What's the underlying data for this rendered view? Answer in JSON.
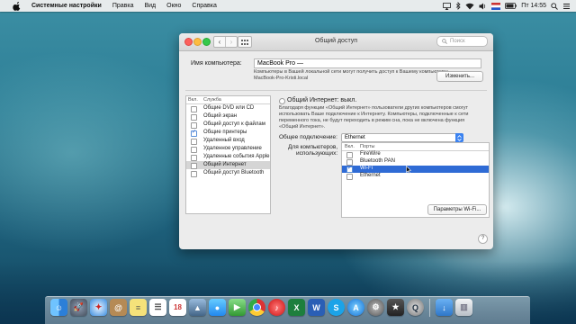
{
  "menubar": {
    "app_name": "Системные настройки",
    "items": [
      "Правка",
      "Вид",
      "Окно",
      "Справка"
    ],
    "clock": "Пт 14:55"
  },
  "window": {
    "title": "Общий доступ",
    "search_placeholder": "Поиск",
    "computer_name_label": "Имя компьютера:",
    "computer_name_value": "MacBook Pro —",
    "name_info_line1": "Компьютеры в Вашей локальной сети могут получить доступ к Вашему компьютеру:",
    "name_info_line2": "MacBook-Pro-Kristi.local",
    "change_button": "Изменить...",
    "services_header_on": "Вкл.",
    "services_header_service": "Служба",
    "services": [
      {
        "label": "Общие DVD или CD",
        "checked": false
      },
      {
        "label": "Общий экран",
        "checked": false
      },
      {
        "label": "Общий доступ к файлам",
        "checked": false
      },
      {
        "label": "Общие принтеры",
        "checked": true
      },
      {
        "label": "Удаленный вход",
        "checked": false
      },
      {
        "label": "Удаленное управление",
        "checked": false
      },
      {
        "label": "Удаленные события Apple",
        "checked": false
      },
      {
        "label": "Общий Интернет",
        "checked": false,
        "selected": true
      },
      {
        "label": "Общий доступ Bluetooth",
        "checked": false
      }
    ],
    "internet_status": "Общий Интернет: выкл.",
    "desc_lines": [
      "Благодаря функции «Общий Интернет» пользователи других компьютеров смогут",
      "использовать Ваше подключение к Интернету. Компьютеры, подключенные к сети",
      "переменного тока, не будут переходить в режим сна, пока не включена функция",
      "«Общий Интернет»."
    ],
    "share_from_label": "Общее подключение:",
    "share_from_value": "Ethernet",
    "to_computers_label1": "Для компьютеров,",
    "to_computers_label2": "использующих:",
    "ports_header_on": "Вкл.",
    "ports_header_ports": "Порты",
    "ports": [
      {
        "label": "FireWire",
        "checked": false
      },
      {
        "label": "Bluetooth PAN",
        "checked": false
      },
      {
        "label": "Wi-Fi",
        "checked": true,
        "selected": true
      },
      {
        "label": "Ethernet",
        "checked": false
      }
    ],
    "wifi_options_button": "Параметры Wi-Fi...",
    "help": "?"
  },
  "dock": {
    "icons": [
      "finder-icon",
      "launchpad-icon",
      "safari-icon",
      "contacts-icon",
      "notes-icon",
      "reminders-icon",
      "calendar-icon",
      "photo-icon",
      "messages-icon",
      "facetime-icon",
      "chrome-icon",
      "itunes-icon",
      "excel-icon",
      "word-icon",
      "skype-icon",
      "appstore-icon",
      "system-preferences-icon",
      "imovie-icon",
      "quicktime-icon",
      "downloads-icon",
      "trash-icon"
    ]
  }
}
